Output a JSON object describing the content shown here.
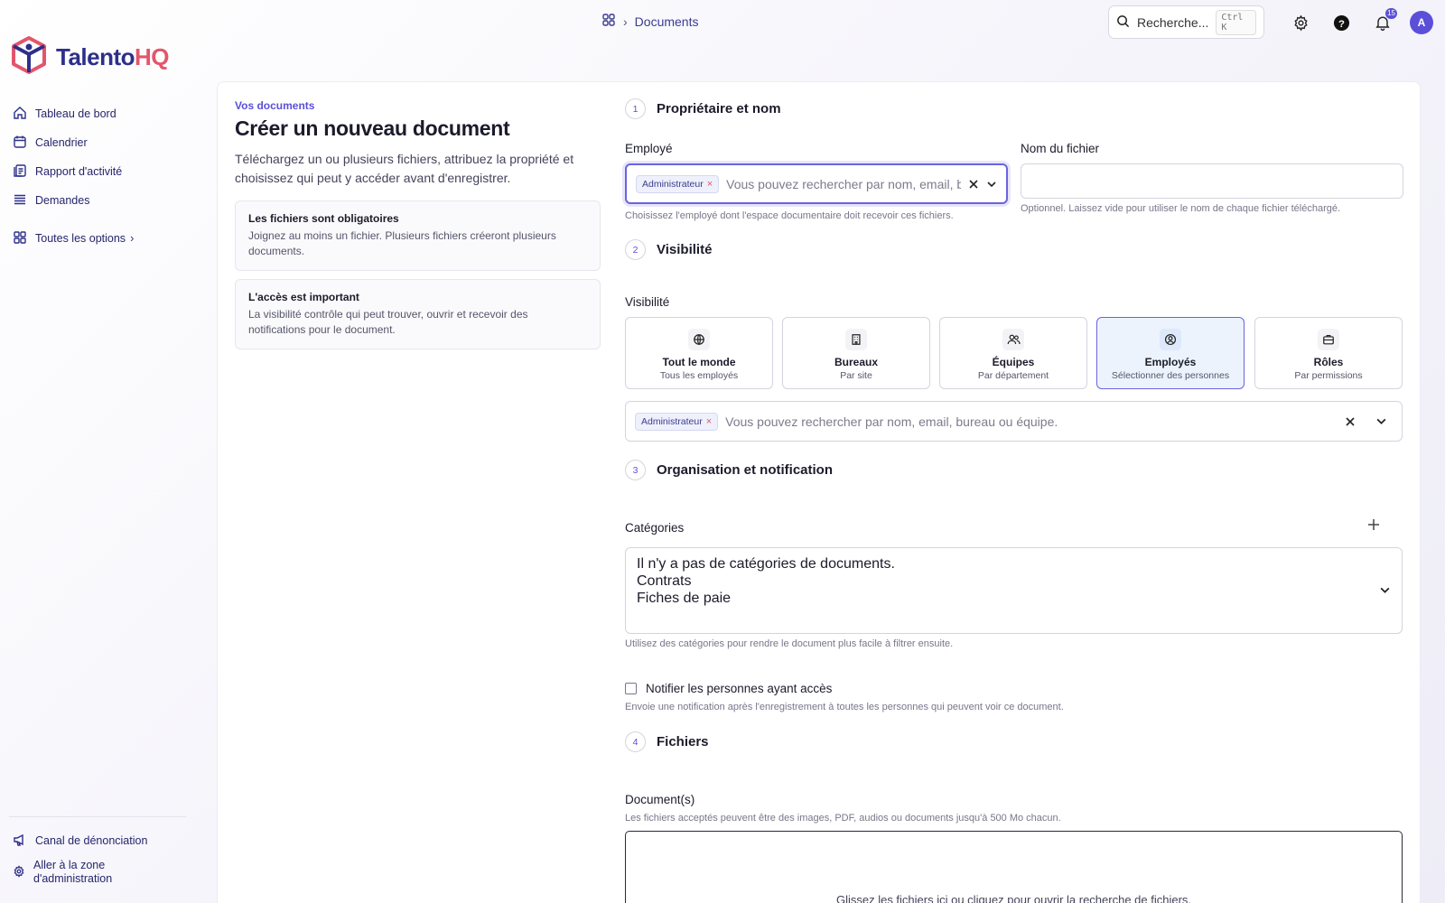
{
  "topbar": {
    "breadcrumb": "Documents",
    "search_placeholder": "Recherche...",
    "search_shortcut": "Ctrl K",
    "notification_count": "15",
    "avatar_initial": "A"
  },
  "brand": {
    "name_part1": "Talento",
    "name_part2": "HQ",
    "accent": "#e2566c",
    "primary": "#2d2f8a"
  },
  "sidebar": {
    "items": [
      {
        "label": "Tableau de bord",
        "icon": "home-icon"
      },
      {
        "label": "Calendrier",
        "icon": "calendar-icon"
      },
      {
        "label": "Rapport d'activité",
        "icon": "report-icon"
      },
      {
        "label": "Demandes",
        "icon": "list-icon"
      }
    ],
    "all_options": "Toutes les options",
    "bottom": [
      {
        "label": "Canal de dénonciation",
        "icon": "megaphone-icon"
      },
      {
        "label": "Aller à la zone d'administration",
        "icon": "gear-icon"
      }
    ]
  },
  "intro": {
    "eyebrow": "Vos documents",
    "title": "Créer un nouveau document",
    "lead": "Téléchargez un ou plusieurs fichiers, attribuez la propriété et choisissez qui peut y accéder avant d'enregistrer.",
    "cards": [
      {
        "title": "Les fichiers sont obligatoires",
        "text": "Joignez au moins un fichier. Plusieurs fichiers créeront plusieurs documents."
      },
      {
        "title": "L'accès est important",
        "text": "La visibilité contrôle qui peut trouver, ouvrir et recevoir des notifications pour le document."
      }
    ]
  },
  "steps": {
    "s1": {
      "num": "1",
      "title": "Propriétaire et nom"
    },
    "s2": {
      "num": "2",
      "title": "Visibilité"
    },
    "s3": {
      "num": "3",
      "title": "Organisation et notification"
    },
    "s4": {
      "num": "4",
      "title": "Fichiers"
    }
  },
  "owner": {
    "employee_label": "Employé",
    "employee_chip": "Administrateur",
    "employee_placeholder": "Vous pouvez rechercher par nom, email, bureau",
    "employee_hint": "Choisissez l'employé dont l'espace documentaire doit recevoir ces fichiers.",
    "filename_label": "Nom du fichier",
    "filename_value": "",
    "filename_hint": "Optionnel. Laissez vide pour utiliser le nom de chaque fichier téléchargé."
  },
  "visibility": {
    "label": "Visibilité",
    "options": [
      {
        "title": "Tout le monde",
        "sub": "Tous les employés",
        "icon": "globe-icon",
        "selected": false
      },
      {
        "title": "Bureaux",
        "sub": "Par site",
        "icon": "building-icon",
        "selected": false
      },
      {
        "title": "Équipes",
        "sub": "Par département",
        "icon": "users-icon",
        "selected": false
      },
      {
        "title": "Employés",
        "sub": "Sélectionner des personnes",
        "icon": "user-circle-icon",
        "selected": true
      },
      {
        "title": "Rôles",
        "sub": "Par permissions",
        "icon": "briefcase-icon",
        "selected": false
      }
    ],
    "chip": "Administrateur",
    "placeholder": "Vous pouvez rechercher par nom, email, bureau ou équipe."
  },
  "organisation": {
    "categories_label": "Catégories",
    "categories": [
      "Il n'y a pas de catégories de documents.",
      "Contrats",
      "Fiches de paie"
    ],
    "categories_hint": "Utilisez des catégories pour rendre le document plus facile à filtrer ensuite.",
    "notify_label": "Notifier les personnes ayant accès",
    "notify_checked": false,
    "notify_hint": "Envoie une notification après l'enregistrement à toutes les personnes qui peuvent voir ce document."
  },
  "files": {
    "label": "Document(s)",
    "hint": "Les fichiers acceptés peuvent être des images, PDF, audios ou documents jusqu'à 500 Mo chacun.",
    "dropzone_text": "Glissez les fichiers ici ou cliquez pour ouvrir la recherche de fichiers."
  }
}
